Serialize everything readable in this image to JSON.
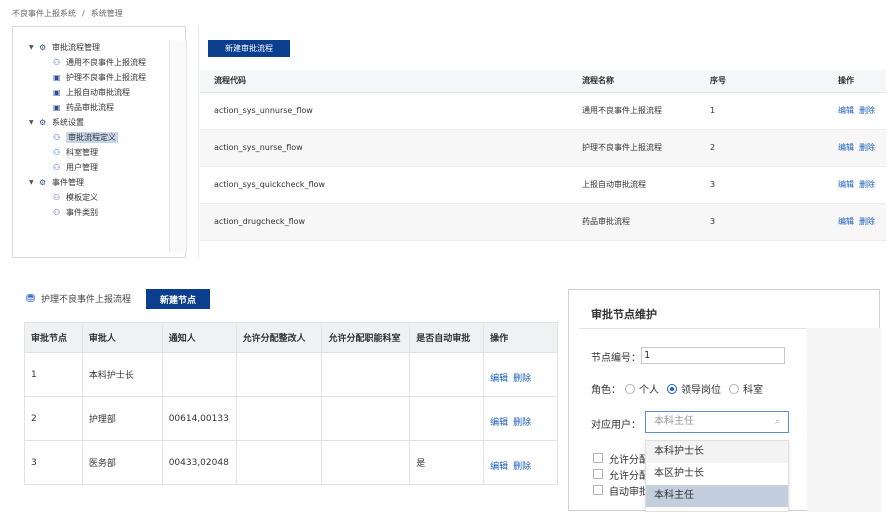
{
  "breadcrumb": {
    "root": "不良事件上报系统",
    "sep": "/",
    "current": "系统管理"
  },
  "tree": {
    "groups": [
      {
        "label": "审批流程管理",
        "items": [
          "通用不良事件上报流程",
          "护理不良事件上报流程",
          "上报自动审批流程",
          "药品审批流程"
        ]
      },
      {
        "label": "系统设置",
        "items": [
          "审批流程定义",
          "科室管理",
          "用户管理"
        ]
      },
      {
        "label": "事件管理",
        "items": [
          "模板定义",
          "事件类别"
        ]
      }
    ]
  },
  "flow": {
    "new_button": "新建审批流程",
    "columns": [
      "流程代码",
      "流程名称",
      "序号",
      "操作"
    ],
    "rows": [
      {
        "code": "action_sys_unnurse_flow",
        "name": "通用不良事件上报流程",
        "seq": "1"
      },
      {
        "code": "action_sys_nurse_flow",
        "name": "护理不良事件上报流程",
        "seq": "2"
      },
      {
        "code": "action_sys_quickcheck_flow",
        "name": "上报自动审批流程",
        "seq": "3"
      },
      {
        "code": "action_drugcheck_flow",
        "name": "药品审批流程",
        "seq": "3"
      }
    ],
    "edit": "编辑",
    "delete": "删除"
  },
  "nodes": {
    "title": "护理不良事件上报流程",
    "new_button": "新建节点",
    "columns": [
      "审批节点",
      "审批人",
      "通知人",
      "允许分配整改人",
      "允许分配职能科室",
      "是否自动审批",
      "操作"
    ],
    "rows": [
      {
        "node": "1",
        "approver": "本科护士长",
        "notify": "",
        "assign": "",
        "dept": "",
        "auto": ""
      },
      {
        "node": "2",
        "approver": "护理部",
        "notify": "00614,00133",
        "assign": "",
        "dept": "",
        "auto": ""
      },
      {
        "node": "3",
        "approver": "医务部",
        "notify": "00433,02048",
        "assign": "",
        "dept": "",
        "auto": "是"
      }
    ],
    "edit": "编辑",
    "delete": "删除"
  },
  "dialog": {
    "title": "审批节点维护",
    "node_no_label": "节点编号：",
    "node_no_value": "1",
    "role_label": "角色：",
    "roles": [
      "个人",
      "领导岗位",
      "科室"
    ],
    "selected_role": "领导岗位",
    "user_label": "对应用户：",
    "user_placeholder": "本科主任",
    "checks": [
      "允许分配整改人",
      "允许分配职能科室",
      "自动审批"
    ],
    "dropdown_options": [
      "本科护士长",
      "本区护士长",
      "本科主任"
    ],
    "dropdown_active": "本科主任"
  }
}
